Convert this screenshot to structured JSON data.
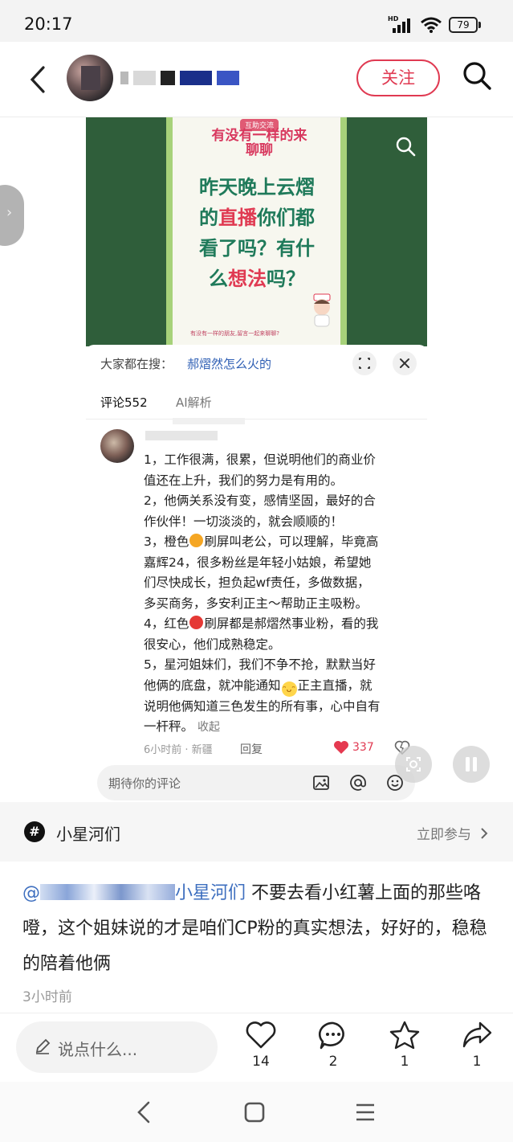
{
  "status_bar": {
    "time": "20:17",
    "network": "HD",
    "battery": "79"
  },
  "header": {
    "follow_label": "关注"
  },
  "image": {
    "poster": {
      "tag": "互助交流",
      "subtitle": "有没有一样的来聊聊",
      "title_line1": "昨天晚上云熠",
      "title_line2_a": "的",
      "title_line2_hl": "直播",
      "title_line2_b": "你们都",
      "title_line3": "看了吗？有什",
      "title_line4_a": "么",
      "title_line4_hl": "想法",
      "title_line4_b": "吗？",
      "footer": "有没有一样的朋友,留言一起来聊聊?"
    },
    "search": {
      "prefix": "大家都在搜：",
      "keyword": "郝熠然怎么火的"
    },
    "tabs": [
      {
        "label": "评论552"
      },
      {
        "label": "AI解析"
      }
    ],
    "comment": {
      "lines": [
        "1，工作很满，很累，但说明他们的商业价",
        "值还在上升，我们的努力是有用的。",
        "2，他俩关系没有变，感情坚固，最好的合",
        "作伙伴！一切淡淡的，就会顺顺的！"
      ],
      "line5_a": "3，橙色",
      "line5_b": "刷屏叫老公，可以理解，毕竟高",
      "lines_mid": [
        "嘉辉24，很多粉丝是年轻小姑娘，希望她",
        "们尽快成长，担负起wf责任，多做数据，",
        "多买商务，多安利正主～帮助正主吸粉。"
      ],
      "line9_a": "4，红色",
      "line9_b": "刷屏都是郝熠然事业粉，看的我",
      "line10": "很安心，他们成熟稳定。",
      "line11": "5，星河姐妹们，我们不争不抢，默默当好",
      "line12_a": "他俩的底盘，就冲能通知",
      "line12_b": "正主直播，就",
      "line13": "说明他俩知道三色发生的所有事，心中自有",
      "line14": "一杆秤。",
      "collapse": "收起",
      "meta": "6小时前 · 新疆",
      "reply": "回复",
      "likes": "337"
    },
    "comment_input_placeholder": "期待你的评论"
  },
  "topic": {
    "name": "小星河们",
    "join": "立即参与"
  },
  "post": {
    "mention_prefix": "@",
    "mention_suffix": "小星河们",
    "text": " 不要去看小红薯上面的那些咯噔，这个姐妹说的才是咱们CP粉的真实想法，好好的，稳稳的陪着他俩",
    "time": "3小时前"
  },
  "actions": {
    "say_placeholder": "说点什么...",
    "like_count": "14",
    "comment_count": "2",
    "collect_count": "1",
    "share_count": "1"
  },
  "colors": {
    "accent": "#e03a52",
    "poster_green": "#2f5e3a",
    "link": "#3e6fbf"
  }
}
